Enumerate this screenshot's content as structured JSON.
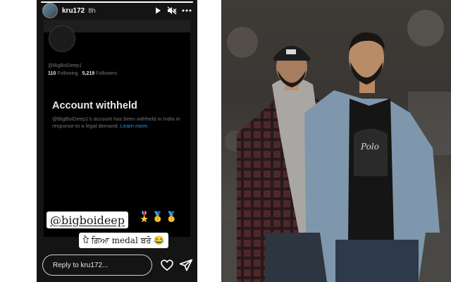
{
  "story": {
    "username": "kru172",
    "time": "8h",
    "progress_fraction": 1.0,
    "header_icons": [
      "play-icon",
      "mute-icon",
      "more-icon"
    ],
    "card": {
      "handle": "@BigBoiDeep1",
      "following_count": "110",
      "following_label": "Following",
      "followers_count": "5,219",
      "followers_label": "Followers",
      "title": "Account withheld",
      "body": "@BigBoiDeep1's account has been withheld in India in response to a legal demand.",
      "link": "Learn more."
    },
    "mention": "@bigboideep",
    "medals": "🎖️🥇🥇",
    "caption": "ਪੈ ਗਿਆ medal ਬਰੋ 😂",
    "reply_placeholder": "Reply to kru172..."
  },
  "colors": {
    "story_bg": "#141414",
    "card_bg": "#000000",
    "link": "#1d9bf0",
    "muted": "#71767b"
  }
}
